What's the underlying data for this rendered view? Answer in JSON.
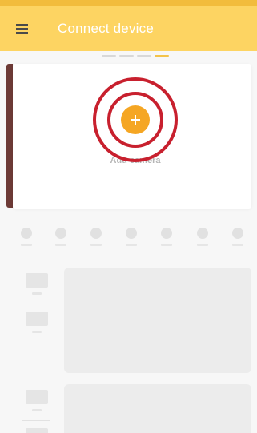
{
  "appbar": {
    "title": "Connect device",
    "menu_icon": "hamburger-menu-icon"
  },
  "colors": {
    "appbar": "#fdd462",
    "statusbar": "#f2bc3c",
    "accent": "#f5a623",
    "highlight": "#c8202e"
  },
  "pager": {
    "count": 4,
    "active_index": 3
  },
  "add_card": {
    "label": "Add camera",
    "button_icon": "plus-icon"
  }
}
